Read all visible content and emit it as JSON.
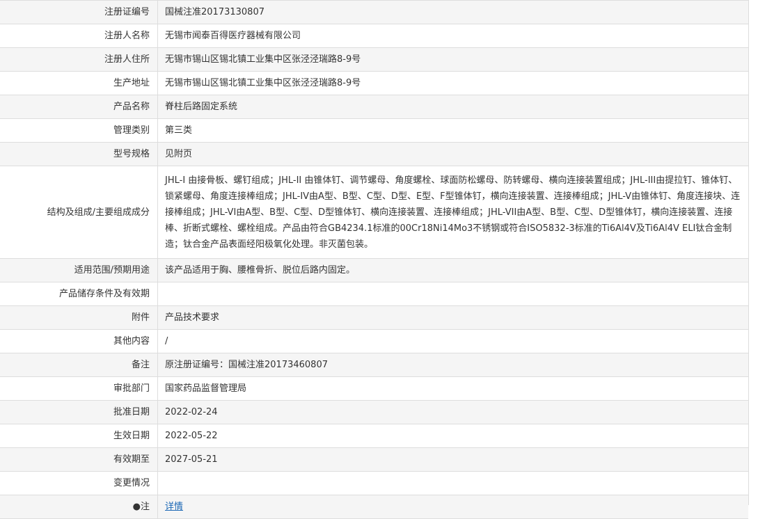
{
  "rows": [
    {
      "label": "注册证编号",
      "value": "国械注准20173130807"
    },
    {
      "label": "注册人名称",
      "value": "无锡市闻泰百得医疗器械有限公司"
    },
    {
      "label": "注册人住所",
      "value": "无锡市锡山区锡北镇工业集中区张泾泾瑞路8-9号"
    },
    {
      "label": "生产地址",
      "value": "无锡市锡山区锡北镇工业集中区张泾泾瑞路8-9号"
    },
    {
      "label": "产品名称",
      "value": "脊柱后路固定系统"
    },
    {
      "label": "管理类别",
      "value": "第三类"
    },
    {
      "label": "型号规格",
      "value": "见附页"
    },
    {
      "label": "结构及组成/主要组成成分",
      "value": "JHL-I 由接骨板、螺钉组成；JHL-II 由锥体钉、调节螺母、角度螺栓、球面防松螺母、防转螺母、横向连接装置组成；JHL-III由提拉钉、锥体钉、锁紧螺母、角度连接棒组成；JHL-IV由A型、B型、C型、D型、E型、F型锥体钉，横向连接装置、连接棒组成；JHL-V由锥体钉、角度连接块、连接棒组成；JHL-VI由A型、B型、C型、D型锥体钉、横向连接装置、连接棒组成；JHL-VII由A型、B型、C型、D型锥体钉，横向连接装置、连接棒、折断式螺栓、螺栓组成。产品由符合GB4234.1标准的00Cr18Ni14Mo3不锈钢或符合ISO5832-3标准的Ti6Al4V及Ti6Al4V ELI钛合金制造；钛合金产品表面经阳极氧化处理。非灭菌包装。"
    },
    {
      "label": "适用范围/预期用途",
      "value": "该产品适用于胸、腰椎骨折、脱位后路内固定。"
    },
    {
      "label": "产品储存条件及有效期",
      "value": ""
    },
    {
      "label": "附件",
      "value": "产品技术要求"
    },
    {
      "label": "其他内容",
      "value": "/"
    },
    {
      "label": "备注",
      "value": "原注册证编号：国械注准20173460807"
    },
    {
      "label": "审批部门",
      "value": "国家药品监督管理局"
    },
    {
      "label": "批准日期",
      "value": "2022-02-24"
    },
    {
      "label": "生效日期",
      "value": "2022-05-22"
    },
    {
      "label": "有效期至",
      "value": "2027-05-21"
    },
    {
      "label": "变更情况",
      "value": ""
    },
    {
      "label": "●注",
      "value": "详情"
    }
  ],
  "colors": {
    "border": "#dddddd",
    "row_alt": "#f5f5f5",
    "link": "#1a67b5"
  }
}
